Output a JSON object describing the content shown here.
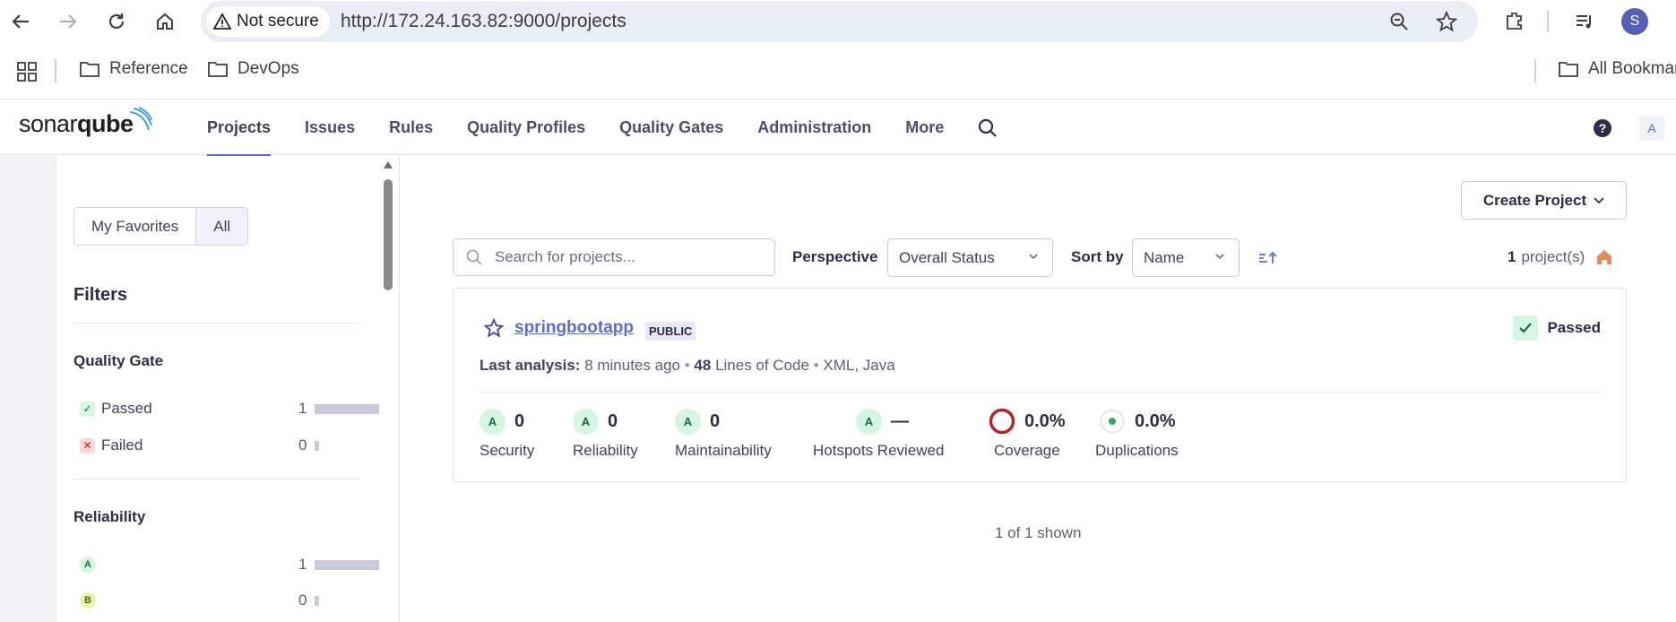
{
  "browser": {
    "security_label": "Not secure",
    "url": "http://172.24.163.82:9000/projects",
    "avatar_letter": "S",
    "bookmarks": [
      "Reference",
      "DevOps"
    ],
    "all_bookmarks": "All Bookmarks"
  },
  "header": {
    "logo_light": "sonar",
    "logo_bold": "qube",
    "nav": [
      "Projects",
      "Issues",
      "Rules",
      "Quality Profiles",
      "Quality Gates",
      "Administration",
      "More"
    ],
    "active_nav": "Projects",
    "user_initial": "A"
  },
  "sidebar": {
    "favorites_label": "My Favorites",
    "all_label": "All",
    "filters_title": "Filters",
    "quality_gate": {
      "title": "Quality Gate",
      "items": [
        {
          "label": "Passed",
          "count": "1",
          "fraction": 1.0
        },
        {
          "label": "Failed",
          "count": "0",
          "fraction": 0.0
        }
      ]
    },
    "reliability": {
      "title": "Reliability",
      "items": [
        {
          "label": "A",
          "count": "1",
          "fraction": 1.0,
          "color": "#d6f5e3"
        },
        {
          "label": "B",
          "count": "0",
          "fraction": 0.0,
          "color": "#e6f5b0"
        }
      ]
    }
  },
  "toolbar": {
    "create_label": "Create Project",
    "search_placeholder": "Search for projects...",
    "perspective_label": "Perspective",
    "perspective_value": "Overall Status",
    "sort_label": "Sort by",
    "sort_value": "Name",
    "count_value": "1",
    "count_suffix": "project(s)"
  },
  "project": {
    "name": "springbootapp",
    "visibility": "PUBLIC",
    "status": "Passed",
    "last_analysis_label": "Last analysis:",
    "last_analysis_value": "8 minutes ago",
    "loc_value": "48",
    "loc_label": "Lines of Code",
    "languages": "XML, Java",
    "measures": [
      {
        "grade": "A",
        "value": "0",
        "label": "Security"
      },
      {
        "grade": "A",
        "value": "0",
        "label": "Reliability"
      },
      {
        "grade": "A",
        "value": "0",
        "label": "Maintainability"
      },
      {
        "grade": "A",
        "value": "—",
        "label": "Hotspots Reviewed"
      },
      {
        "value": "0.0%",
        "label": "Coverage"
      },
      {
        "value": "0.0%",
        "label": "Duplications"
      }
    ]
  },
  "footer": {
    "shown": "1 of 1 shown"
  },
  "colors": {
    "accent": "#5d6cd0",
    "passed": "#d6f5e3",
    "failed": "#fcd9d9"
  }
}
